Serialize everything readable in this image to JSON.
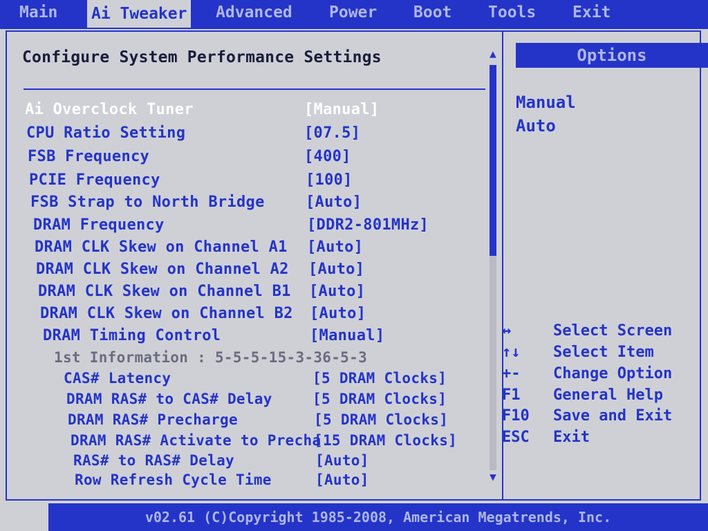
{
  "menu": {
    "tabs": [
      {
        "label": "Main"
      },
      {
        "label": "Ai Tweaker"
      },
      {
        "label": "Advanced"
      },
      {
        "label": "Power"
      },
      {
        "label": "Boot"
      },
      {
        "label": "Tools"
      },
      {
        "label": "Exit"
      }
    ],
    "active_tab": "Ai Tweaker"
  },
  "main": {
    "title": "Configure System Performance Settings",
    "settings": [
      {
        "label": "Ai Overclock Tuner",
        "value": "[Manual]",
        "selected": true
      },
      {
        "label": "CPU Ratio Setting",
        "value": "[07.5]"
      },
      {
        "label": "FSB Frequency",
        "value": "[400]"
      },
      {
        "label": "PCIE Frequency",
        "value": "[100]"
      },
      {
        "label": "FSB Strap to North Bridge",
        "value": "[Auto]"
      },
      {
        "label": "DRAM Frequency",
        "value": "[DDR2-801MHz]"
      },
      {
        "label": "DRAM CLK Skew on Channel A1",
        "value": "[Auto]"
      },
      {
        "label": "DRAM CLK Skew on Channel A2",
        "value": "[Auto]"
      },
      {
        "label": "DRAM CLK Skew on Channel B1",
        "value": "[Auto]"
      },
      {
        "label": "DRAM CLK Skew on Channel B2",
        "value": "[Auto]"
      },
      {
        "label": "DRAM Timing Control",
        "value": "[Manual]"
      }
    ],
    "info_line": "1st Information : 5-5-5-15-3-36-5-3",
    "sub_settings": [
      {
        "label": "CAS# Latency",
        "value": "[5 DRAM Clocks]"
      },
      {
        "label": "DRAM RAS# to CAS# Delay",
        "value": "[5 DRAM Clocks]"
      },
      {
        "label": "DRAM RAS# Precharge",
        "value": "[5 DRAM Clocks]"
      },
      {
        "label": "DRAM RAS# Activate to Precha",
        "value": "[15 DRAM Clocks]"
      },
      {
        "label": "RAS# to RAS# Delay",
        "value": "[Auto]"
      },
      {
        "label": "Row Refresh Cycle Time",
        "value": "[Auto]"
      }
    ]
  },
  "options_panel": {
    "header": "Options",
    "items": [
      "Manual",
      "Auto"
    ]
  },
  "help": [
    {
      "key": "↔",
      "desc": "Select Screen"
    },
    {
      "key": "↑↓",
      "desc": "Select Item"
    },
    {
      "key": "+-",
      "desc": "Change Option"
    },
    {
      "key": "F1",
      "desc": "General Help"
    },
    {
      "key": "F10",
      "desc": "Save and Exit"
    },
    {
      "key": "ESC",
      "desc": "Exit"
    }
  ],
  "footer": "v02.61 (C)Copyright 1985-2008, American Megatrends, Inc.",
  "colors": {
    "bios_blue": "#2434c8",
    "background": "#cfd0d6",
    "selected_text": "#ffffff",
    "info_gray": "#6a6d80"
  }
}
